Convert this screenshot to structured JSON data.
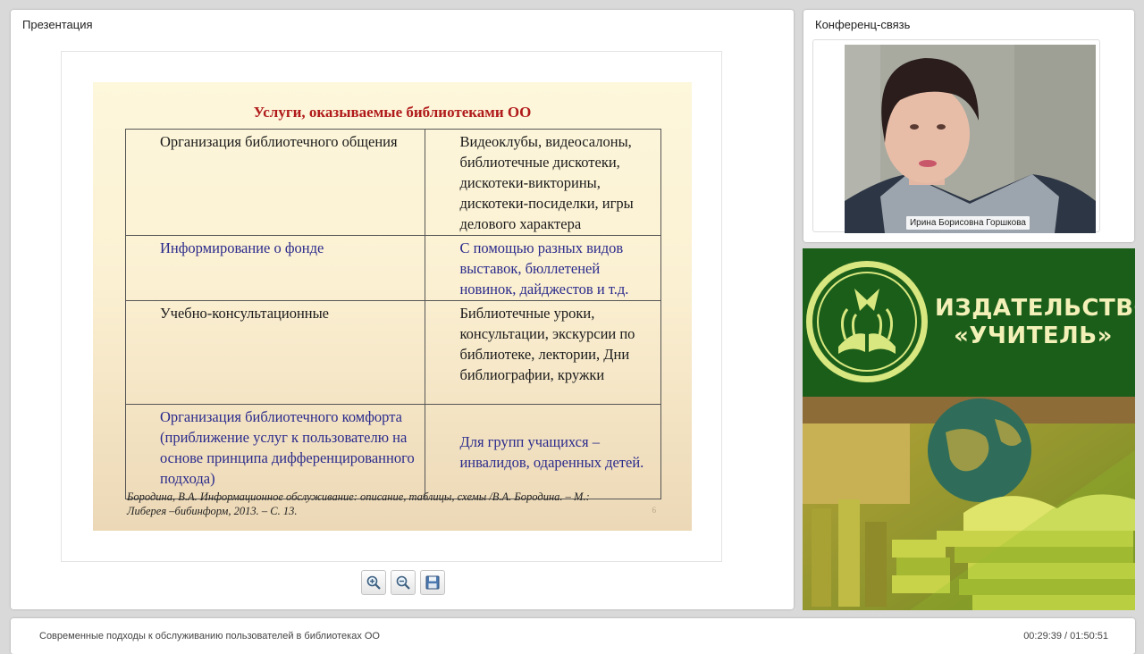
{
  "presentation": {
    "title": "Презентация",
    "slide": {
      "title": "Услуги, оказываемые библиотеками ОО",
      "rows": [
        {
          "service": "Организация библиотечного общения",
          "details": "Видеоклубы, видеосалоны, библиотечные дискотеки, дискотеки-викторины, дискотеки-посиделки, игры делового характера",
          "color": "#1a1a1a"
        },
        {
          "service": "Информирование о фонде",
          "details": "С помощью разных видов выставок, бюллетеней новинок, дайджестов и т.д.",
          "color": "#2a2a8c"
        },
        {
          "service": "Учебно-консультационные",
          "details": "Библиотечные уроки, консультации, экскурсии по библиотеке, лектории, Дни библиографии, кружки",
          "color": "#1a1a1a"
        },
        {
          "service": "Организация библиотечного комфорта (приближение услуг к пользователю на основе принципа дифференцированного подхода)",
          "details": "Для групп учащихся – инвалидов, одаренных детей.",
          "color": "#2a2a8c"
        }
      ],
      "citation": "Бородина, В.А. Информационное обслуживание: описание, таблицы, схемы /В.А. Бородина. – М.: Либерея –бибинформ, 2013. – С. 13.",
      "page_number": "6"
    },
    "toolbar": {
      "zoom_in_icon": "zoom-in-icon",
      "zoom_out_icon": "zoom-out-icon",
      "save_icon": "save-icon"
    }
  },
  "conference": {
    "title": "Конференц-связь",
    "speaker_name": "Ирина Борисовна Горшкова"
  },
  "banner": {
    "line1": "ИЗДАТЕЛЬСТВО",
    "line2": "«УЧИТЕЛЬ»",
    "colors": {
      "green": "#1b5e1a",
      "text": "#f3f1b8"
    }
  },
  "footer": {
    "lecture_title": "Современные подходы к обслуживанию пользователей в библиотеках ОО",
    "time": "00:29:39 / 01:50:51"
  }
}
